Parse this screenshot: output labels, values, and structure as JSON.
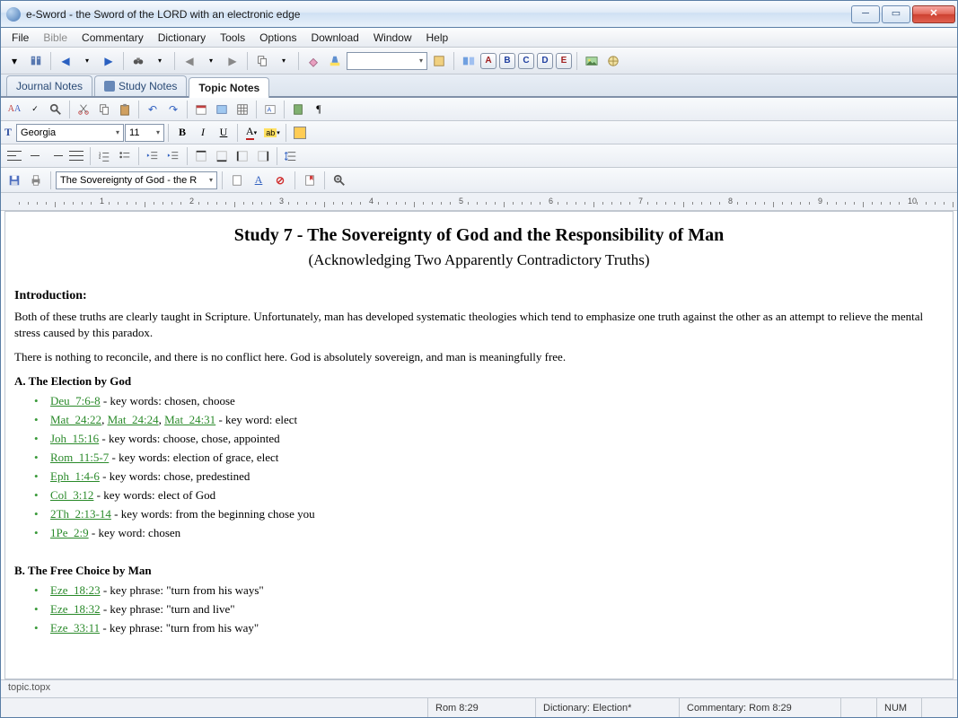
{
  "window": {
    "title": "e-Sword - the Sword of the LORD with an electronic edge"
  },
  "menubar": [
    "File",
    "Bible",
    "Commentary",
    "Dictionary",
    "Tools",
    "Options",
    "Download",
    "Window",
    "Help"
  ],
  "menubar_dim": [
    1
  ],
  "main_toolbar": {
    "letters": [
      "A",
      "B",
      "C",
      "D",
      "E"
    ]
  },
  "tabs": [
    {
      "label": "Journal Notes",
      "active": false
    },
    {
      "label": "Study Notes",
      "active": false,
      "icon": true
    },
    {
      "label": "Topic Notes",
      "active": true
    }
  ],
  "font": {
    "name": "Georgia",
    "size": "11"
  },
  "topic_combo": "The Sovereignty of God - the R",
  "ruler_marks": [
    "1",
    "2",
    "3",
    "4",
    "5",
    "6",
    "7",
    "8",
    "9",
    "10"
  ],
  "doc": {
    "title": "Study 7 - The Sovereignty of God and the Responsibility of Man",
    "subtitle": "(Acknowledging Two Apparently Contradictory Truths)",
    "intro_h": "Introduction:",
    "intro_p1": "Both of these truths are clearly taught in Scripture.  Unfortunately, man has developed systematic theologies which tend to emphasize one truth against the other as an attempt to relieve the mental stress caused by this paradox.",
    "intro_p2": "There is nothing to reconcile, and there is no conflict here.  God is absolutely sovereign, and man is meaningfully free.",
    "sectionA": {
      "heading": "A.  The Election by God",
      "items": [
        {
          "refs": [
            "Deu_7:6-8"
          ],
          "tail": " - key words: chosen, choose"
        },
        {
          "refs": [
            "Mat_24:22",
            "Mat_24:24",
            "Mat_24:31"
          ],
          "tail": " - key word: elect"
        },
        {
          "refs": [
            "Joh_15:16"
          ],
          "tail": " - key words: choose, chose, appointed"
        },
        {
          "refs": [
            "Rom_11:5-7"
          ],
          "tail": " - key words: election of grace, elect"
        },
        {
          "refs": [
            "Eph_1:4-6"
          ],
          "tail": " - key words: chose, predestined"
        },
        {
          "refs": [
            "Col_3:12"
          ],
          "tail": " - key words: elect of God"
        },
        {
          "refs": [
            "2Th_2:13-14"
          ],
          "tail": " - key words: from the beginning chose you"
        },
        {
          "refs": [
            "1Pe_2:9"
          ],
          "tail": " - key word: chosen"
        }
      ]
    },
    "sectionB": {
      "heading": "B.  The Free Choice by Man",
      "items": [
        {
          "refs": [
            "Eze_18:23"
          ],
          "tail": " - key phrase: \"turn from his ways\""
        },
        {
          "refs": [
            "Eze_18:32"
          ],
          "tail": " - key phrase: \"turn and live\""
        },
        {
          "refs": [
            "Eze_33:11"
          ],
          "tail": " - key phrase: \"turn from his way\""
        }
      ]
    }
  },
  "tabfile": "topic.topx",
  "status": {
    "ref": "Rom 8:29",
    "dict": "Dictionary: Election*",
    "comm": "Commentary: Rom 8:29",
    "num": "NUM"
  }
}
